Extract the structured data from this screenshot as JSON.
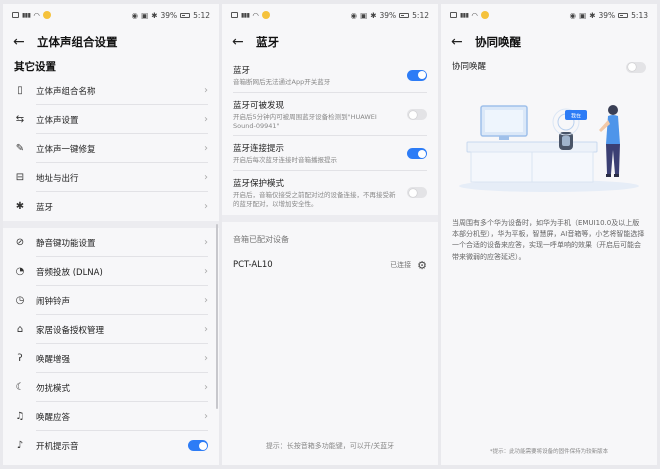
{
  "status_bars": [
    {
      "battery": "39%",
      "time": "5:12"
    },
    {
      "battery": "39%",
      "time": "5:12"
    },
    {
      "battery": "39%",
      "time": "5:13"
    }
  ],
  "panel1": {
    "title": "立体声组合设置",
    "section": "其它设置",
    "items": [
      {
        "label": "立体声组合名称",
        "icon": "speaker-icon"
      },
      {
        "label": "立体声设置",
        "icon": "swap-icon"
      },
      {
        "label": "立体声一键修复",
        "icon": "wrench-icon"
      },
      {
        "label": "地址与出行",
        "icon": "car-icon"
      },
      {
        "label": "蓝牙",
        "icon": "bluetooth-icon"
      },
      {
        "label": "静音键功能设置",
        "icon": "mic-off-icon"
      },
      {
        "label": "音频投放 (DLNA)",
        "icon": "cast-icon"
      },
      {
        "label": "闹钟铃声",
        "icon": "alarm-icon"
      },
      {
        "label": "家居设备授权管理",
        "icon": "home-settings-icon"
      },
      {
        "label": "唤醒增强",
        "icon": "ear-icon"
      },
      {
        "label": "勿扰模式",
        "icon": "moon-icon"
      },
      {
        "label": "唤醒应答",
        "icon": "bell-icon"
      },
      {
        "label": "开机提示音",
        "icon": "power-sound-icon"
      }
    ]
  },
  "panel2": {
    "title": "蓝牙",
    "settings": [
      {
        "title": "蓝牙",
        "subtitle": "音箱断网后无法通过App开关蓝牙",
        "on": true
      },
      {
        "title": "蓝牙可被发现",
        "subtitle": "开启后5分钟内可被周围蓝牙设备检测到\"HUAWEI Sound-09941\"",
        "on": false
      },
      {
        "title": "蓝牙连接提示",
        "subtitle": "开启后每次蓝牙连接时音箱播报提示",
        "on": true
      },
      {
        "title": "蓝牙保护模式",
        "subtitle": "开启后，音箱仅接受之前配对过的设备连接，不再接受新的蓝牙配对，以增加安全性。",
        "on": false
      }
    ],
    "paired_header": "音箱已配对设备",
    "device_name": "PCT-AL10",
    "device_state": "已连接",
    "hint": "提示：长按音箱多功能键，可以开/关蓝牙"
  },
  "panel3": {
    "title": "协同唤醒",
    "toggle_label": "协同唤醒",
    "bubble": "我在",
    "description": "当周围有多个华为设备时，如华为手机（EMUI10.0及以上版本部分机型），华为平板，智慧屏，AI音箱等，小艺将智能选择一个合适的设备来应答，实现一呼单响的效果（开启后可能会带来微弱的应答延迟）。",
    "footnote": "*提示：此功能需要将设备的固件保持为较新版本"
  },
  "colors": {
    "accent": "#2d7cf6"
  }
}
